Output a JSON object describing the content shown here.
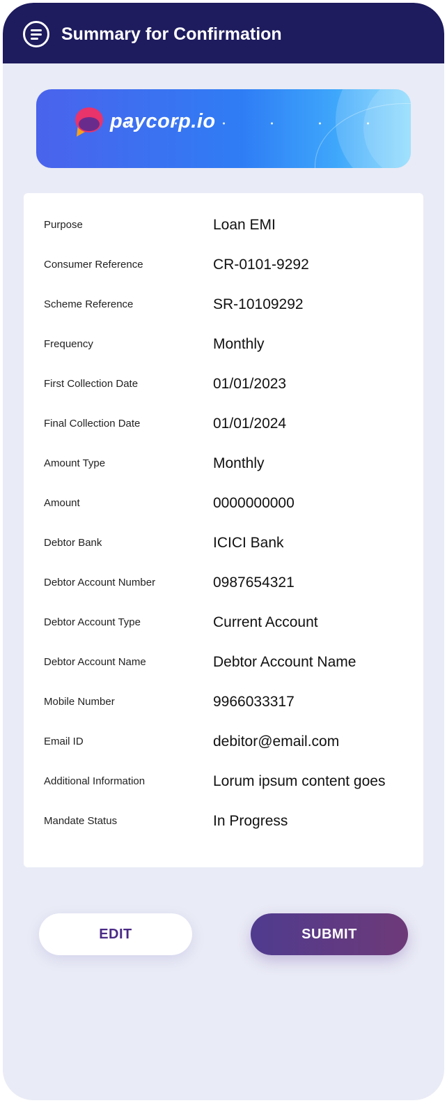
{
  "header": {
    "title": "Summary for Confirmation",
    "menu_icon": "menu-icon"
  },
  "banner": {
    "brand": "paycorp.io",
    "logo_icon": "paycorp-logo-icon"
  },
  "summary": {
    "rows": [
      {
        "label": "Purpose",
        "value": "Loan EMI"
      },
      {
        "label": "Consumer Reference",
        "value": "CR-0101-9292"
      },
      {
        "label": "Scheme Reference",
        "value": "SR-10109292"
      },
      {
        "label": "Frequency",
        "value": "Monthly"
      },
      {
        "label": "First Collection Date",
        "value": "01/01/2023"
      },
      {
        "label": "Final Collection Date",
        "value": "01/01/2024"
      },
      {
        "label": "Amount Type",
        "value": "Monthly"
      },
      {
        "label": "Amount",
        "value": "0000000000"
      },
      {
        "label": "Debtor Bank",
        "value": "ICICI Bank"
      },
      {
        "label": "Debtor Account Number",
        "value": "0987654321"
      },
      {
        "label": "Debtor Account Type",
        "value": "Current Account"
      },
      {
        "label": "Debtor Account Name",
        "value": "Debtor Account Name"
      },
      {
        "label": "Mobile Number",
        "value": "9966033317"
      },
      {
        "label": "Email ID",
        "value": "debitor@email.com"
      },
      {
        "label": "Additional Information",
        "value": "Lorum ipsum content goes"
      },
      {
        "label": "Mandate Status",
        "value": "In Progress"
      }
    ]
  },
  "actions": {
    "edit_label": "EDIT",
    "submit_label": "SUBMIT"
  },
  "colors": {
    "header_bg": "#1e1b5e",
    "page_bg": "#e9ebf6",
    "accent_purple": "#4a2a86",
    "submit_gradient_start": "#4f3b8f",
    "submit_gradient_end": "#6e3a78",
    "banner_blue": "#2f7df5"
  }
}
